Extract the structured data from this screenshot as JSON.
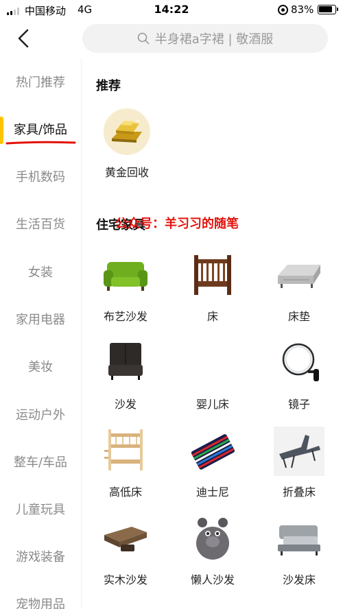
{
  "status_bar": {
    "carrier": "中国移动",
    "network": "4G",
    "time": "14:22",
    "battery": "83%"
  },
  "search": {
    "placeholder": "半身裙a字裙 | 敬酒服"
  },
  "sidebar": {
    "items": [
      {
        "label": "热门推荐",
        "active": false
      },
      {
        "label": "家具/饰品",
        "active": true
      },
      {
        "label": "手机数码",
        "active": false
      },
      {
        "label": "生活百货",
        "active": false
      },
      {
        "label": "女装",
        "active": false
      },
      {
        "label": "家用电器",
        "active": false
      },
      {
        "label": "美妆",
        "active": false
      },
      {
        "label": "运动户外",
        "active": false
      },
      {
        "label": "整车/车品",
        "active": false
      },
      {
        "label": "儿童玩具",
        "active": false
      },
      {
        "label": "游戏装备",
        "active": false
      },
      {
        "label": "宠物用品",
        "active": false
      }
    ]
  },
  "main": {
    "recommend": {
      "title": "推荐",
      "items": [
        {
          "label": "黄金回收",
          "icon": "gold-bar-icon"
        }
      ]
    },
    "residential": {
      "title": "住宅家具",
      "items": [
        {
          "label": "布艺沙发",
          "icon": "green-sofa-image"
        },
        {
          "label": "床",
          "icon": "wooden-bed-image"
        },
        {
          "label": "床垫",
          "icon": "mattress-image"
        },
        {
          "label": "沙发",
          "icon": "black-sofa-image"
        },
        {
          "label": "婴儿床",
          "icon": "crib-image"
        },
        {
          "label": "镜子",
          "icon": "mirror-image"
        },
        {
          "label": "高低床",
          "icon": "bunk-bed-image"
        },
        {
          "label": "迪士尼",
          "icon": "striped-mat-image"
        },
        {
          "label": "折叠床",
          "icon": "folding-bed-image"
        },
        {
          "label": "实木沙发",
          "icon": "wood-sofa-image"
        },
        {
          "label": "懒人沙发",
          "icon": "bean-bag-image"
        },
        {
          "label": "沙发床",
          "icon": "sofa-bed-image"
        }
      ]
    }
  },
  "watermark": {
    "text": "公众号：羊习习的随笔"
  },
  "colors": {
    "active_indicator": "#ffc400",
    "active_underline": "#e3120b",
    "watermark": "#e3120b",
    "search_bg": "#f2f2f2",
    "muted_text": "#8a8a8a"
  }
}
